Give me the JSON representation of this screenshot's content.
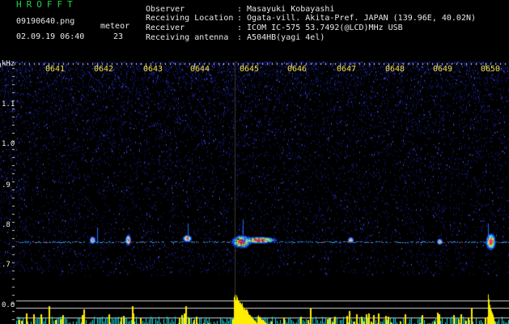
{
  "header": {
    "brand": "HROFFT",
    "filename": "09190640.png",
    "datetime": "02.09.19 06:40",
    "counter_label": "meteor",
    "counter_value": "23",
    "info": [
      {
        "label": "Observer",
        "value": ": Masayuki Kobayashi"
      },
      {
        "label": "Receiving Location",
        "value": ": Ogata-vill. Akita-Pref. JAPAN (139.96E, 40.02N)"
      },
      {
        "label": "Receiver",
        "value": ": ICOM IC-575 53.7492(@LCD)MHz USB"
      },
      {
        "label": "Receiving antenna",
        "value": ": A504HB(yagi 4el)"
      }
    ]
  },
  "time_axis": {
    "labels": [
      "0641",
      "0642",
      "0643",
      "0644",
      "0645",
      "0646",
      "0647",
      "0648",
      "0649",
      "0650"
    ]
  },
  "freq_axis": {
    "unit": "kHz",
    "labels": [
      "1.1",
      "1.0",
      ".9",
      ".8",
      ".7",
      "0.6"
    ]
  },
  "colors": {
    "header_brand": "#1fd44a",
    "header_text": "#e8e8e8",
    "time_labels": "#f2e24a",
    "signal_line": "#2aa8ff",
    "meteor_head": "#ff3a6e",
    "level_bars": "#ffee00",
    "noise_bars": "#19e0e0"
  }
}
